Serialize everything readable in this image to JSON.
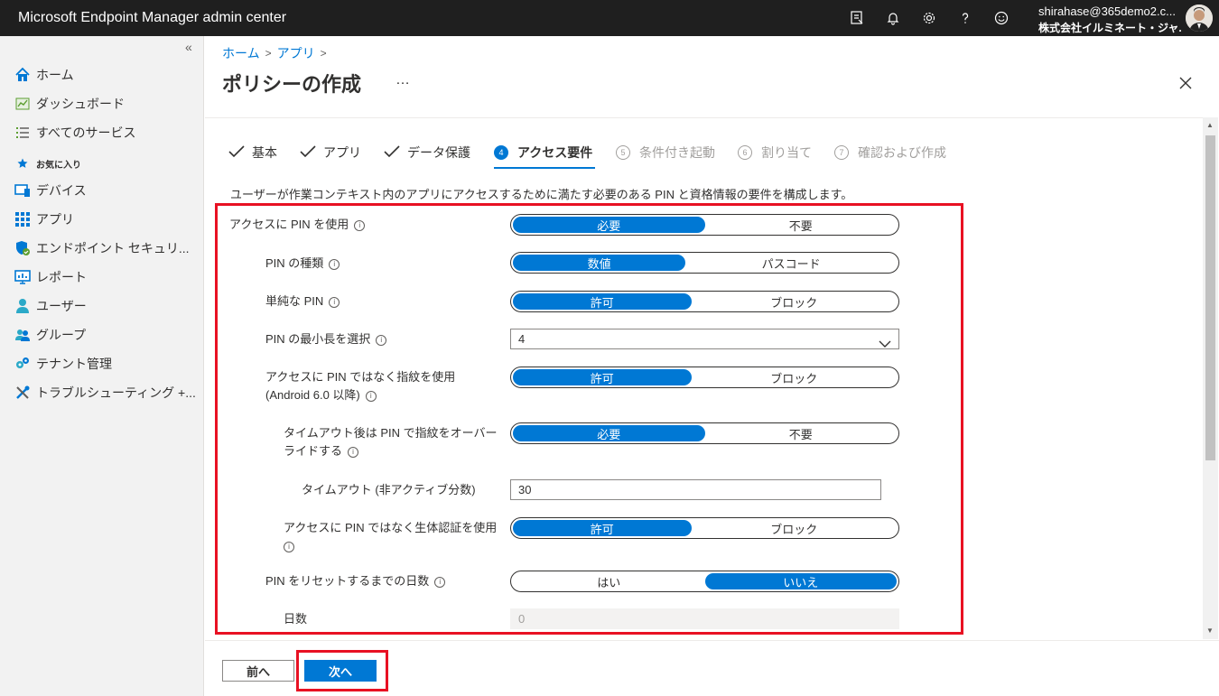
{
  "app": {
    "title": "Microsoft Endpoint Manager admin center",
    "user_email": "shirahase@365demo2.c...",
    "user_org": "株式会社イルミネート・ジャ..."
  },
  "topbar_icons": [
    "feedback-device-icon",
    "bell-icon",
    "gear-icon",
    "help-icon",
    "smiley-icon"
  ],
  "sidebar": {
    "collapse": "«",
    "favorites_label": "お気に入り",
    "items": [
      {
        "label": "ホーム",
        "icon": "home-icon"
      },
      {
        "label": "ダッシュボード",
        "icon": "dashboard-icon"
      },
      {
        "label": "すべてのサービス",
        "icon": "list-icon"
      },
      {
        "label": "デバイス",
        "icon": "devices-icon"
      },
      {
        "label": "アプリ",
        "icon": "apps-icon"
      },
      {
        "label": "エンドポイント セキュリ...",
        "icon": "shield-icon"
      },
      {
        "label": "レポート",
        "icon": "reports-icon"
      },
      {
        "label": "ユーザー",
        "icon": "user-icon"
      },
      {
        "label": "グループ",
        "icon": "group-icon"
      },
      {
        "label": "テナント管理",
        "icon": "tenant-icon"
      },
      {
        "label": "トラブルシューティング +...",
        "icon": "tools-icon"
      }
    ]
  },
  "breadcrumb": [
    "ホーム",
    "アプリ"
  ],
  "page": {
    "title": "ポリシーの作成",
    "more": "…"
  },
  "steps": [
    {
      "label": "基本",
      "state": "done"
    },
    {
      "label": "アプリ",
      "state": "done"
    },
    {
      "label": "データ保護",
      "state": "done"
    },
    {
      "label": "アクセス要件",
      "state": "active",
      "num": "4"
    },
    {
      "label": "条件付き起動",
      "state": "pending",
      "num": "5"
    },
    {
      "label": "割り当て",
      "state": "pending",
      "num": "6"
    },
    {
      "label": "確認および作成",
      "state": "pending",
      "num": "7"
    }
  ],
  "description": "ユーザーが作業コンテキスト内のアプリにアクセスするために満たす必要のある PIN と資格情報の要件を構成します。",
  "fields": {
    "pin_access": {
      "label": "アクセスに PIN を使用",
      "options": [
        "必要",
        "不要"
      ],
      "selected": "必要"
    },
    "pin_type": {
      "label": "PIN の種類",
      "options": [
        "数値",
        "パスコード"
      ],
      "selected": "数値"
    },
    "simple_pin": {
      "label": "単純な PIN",
      "options": [
        "許可",
        "ブロック"
      ],
      "selected": "許可"
    },
    "pin_min_length": {
      "label": "PIN の最小長を選択",
      "value": "4"
    },
    "fingerprint": {
      "label_line1": "アクセスに PIN ではなく指紋を使用",
      "label_line2": "(Android 6.0 以降)",
      "options": [
        "許可",
        "ブロック"
      ],
      "selected": "許可"
    },
    "override_fingerprint": {
      "label_line1": "タイムアウト後は PIN で指紋をオーバー",
      "label_line2": "ライドする",
      "options": [
        "必要",
        "不要"
      ],
      "selected": "必要"
    },
    "timeout": {
      "label": "タイムアウト (非アクティブ分数)",
      "value": "30"
    },
    "biometric": {
      "label_line1": "アクセスに PIN ではなく生体認証を使用",
      "options": [
        "許可",
        "ブロック"
      ],
      "selected": "許可"
    },
    "pin_reset_days": {
      "label": "PIN をリセットするまでの日数",
      "options": [
        "はい",
        "いいえ"
      ],
      "selected": "いいえ"
    },
    "days": {
      "label": "日数",
      "value": "0"
    }
  },
  "footer": {
    "prev": "前へ",
    "next": "次へ"
  },
  "colors": {
    "accent": "#0078d4",
    "highlight": "#e81123",
    "topbar": "#1f1f1f"
  }
}
